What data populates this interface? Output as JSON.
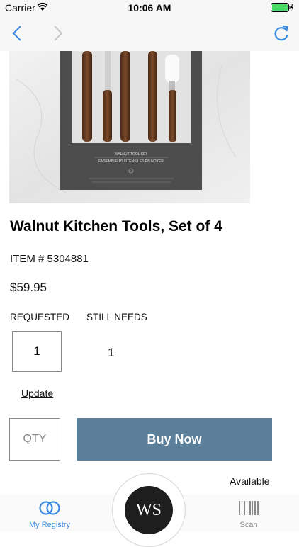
{
  "status_bar": {
    "carrier": "Carrier",
    "time": "10:06 AM"
  },
  "nav": {
    "back_icon": "chevron-left-icon",
    "forward_icon": "chevron-right-icon",
    "refresh_icon": "refresh-icon"
  },
  "product": {
    "title": "Walnut Kitchen Tools, Set of 4",
    "item_number": "ITEM # 5304881",
    "price": "$59.95",
    "package_text": {
      "line1": "WALNUT TOOL SET",
      "line2": "ENSEMBLE D'USTENSILES EN NOYER"
    }
  },
  "registry": {
    "requested_label": "REQUESTED",
    "still_needs_label": "STILL NEEDS",
    "requested_value": "1",
    "still_needs_value": "1",
    "update_label": "Update"
  },
  "purchase": {
    "qty_placeholder": "QTY",
    "buy_label": "Buy Now",
    "availability": "Available"
  },
  "tab_bar": {
    "my_registry_label": "My Registry",
    "center_logo": "WS",
    "scan_label": "Scan"
  },
  "colors": {
    "accent": "#3a8be0",
    "buy_button": "#5b7f98",
    "logo_bg": "#1e1e1e"
  }
}
